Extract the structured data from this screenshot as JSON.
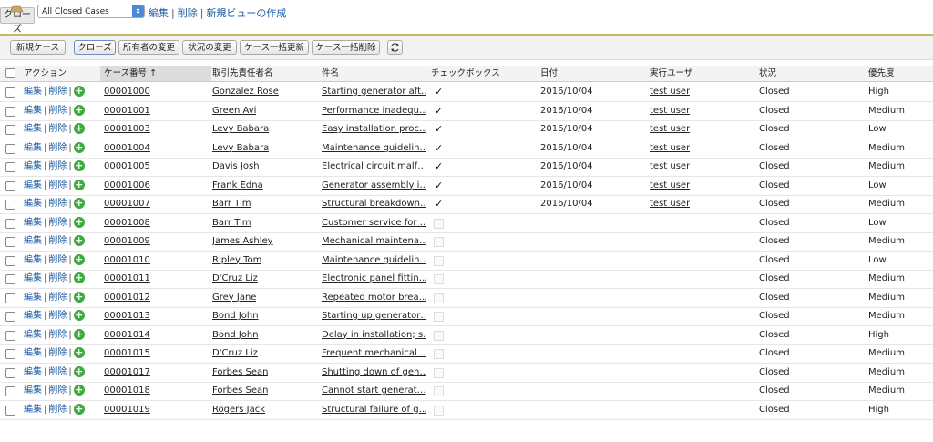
{
  "tab": {
    "label": "クローズ"
  },
  "view": {
    "selected": "All Closed Cases",
    "links": [
      "編集",
      "削除",
      "新規ビューの作成"
    ]
  },
  "toolbar": {
    "buttons": [
      "新規ケース",
      "クローズ",
      "所有者の変更",
      "状況の変更",
      "ケース一括更新",
      "ケース一括削除"
    ]
  },
  "table": {
    "headers": [
      "アクション",
      "ケース番号",
      "取引先責任者名",
      "件名",
      "チェックボックス",
      "日付",
      "実行ユーザ",
      "状況",
      "優先度"
    ],
    "sort_indicator": "↑",
    "action_edit": "編集",
    "action_delete": "削除",
    "action_plus": "+",
    "check_mark": "✓",
    "rows": [
      {
        "case": "00001000",
        "contact": "Gonzalez Rose",
        "subject": "Starting generator aft…",
        "checked": true,
        "date": "2016/10/04",
        "user": "test user",
        "status": "Closed",
        "priority": "High"
      },
      {
        "case": "00001001",
        "contact": "Green Avi",
        "subject": "Performance inadequ…",
        "checked": true,
        "date": "2016/10/04",
        "user": "test user",
        "status": "Closed",
        "priority": "Medium"
      },
      {
        "case": "00001003",
        "contact": "Levy Babara",
        "subject": "Easy installation proc…",
        "checked": true,
        "date": "2016/10/04",
        "user": "test user",
        "status": "Closed",
        "priority": "Low"
      },
      {
        "case": "00001004",
        "contact": "Levy Babara",
        "subject": "Maintenance guidelin…",
        "checked": true,
        "date": "2016/10/04",
        "user": "test user",
        "status": "Closed",
        "priority": "Medium"
      },
      {
        "case": "00001005",
        "contact": "Davis Josh",
        "subject": "Electrical circuit malf…",
        "checked": true,
        "date": "2016/10/04",
        "user": "test user",
        "status": "Closed",
        "priority": "Medium"
      },
      {
        "case": "00001006",
        "contact": "Frank Edna",
        "subject": "Generator assembly i…",
        "checked": true,
        "date": "2016/10/04",
        "user": "test user",
        "status": "Closed",
        "priority": "Low"
      },
      {
        "case": "00001007",
        "contact": "Barr Tim",
        "subject": "Structural breakdown…",
        "checked": true,
        "date": "2016/10/04",
        "user": "test user",
        "status": "Closed",
        "priority": "Medium"
      },
      {
        "case": "00001008",
        "contact": "Barr Tim",
        "subject": "Customer service for …",
        "checked": false,
        "date": "",
        "user": "",
        "status": "Closed",
        "priority": "Low"
      },
      {
        "case": "00001009",
        "contact": "James Ashley",
        "subject": "Mechanical maintena…",
        "checked": false,
        "date": "",
        "user": "",
        "status": "Closed",
        "priority": "Medium"
      },
      {
        "case": "00001010",
        "contact": "Ripley Tom",
        "subject": "Maintenance guidelin…",
        "checked": false,
        "date": "",
        "user": "",
        "status": "Closed",
        "priority": "Low"
      },
      {
        "case": "00001011",
        "contact": "D'Cruz Liz",
        "subject": "Electronic panel fittin…",
        "checked": false,
        "date": "",
        "user": "",
        "status": "Closed",
        "priority": "Medium"
      },
      {
        "case": "00001012",
        "contact": "Grey Jane",
        "subject": "Repeated motor brea…",
        "checked": false,
        "date": "",
        "user": "",
        "status": "Closed",
        "priority": "Medium"
      },
      {
        "case": "00001013",
        "contact": "Bond John",
        "subject": "Starting up generator…",
        "checked": false,
        "date": "",
        "user": "",
        "status": "Closed",
        "priority": "Medium"
      },
      {
        "case": "00001014",
        "contact": "Bond John",
        "subject": "Delay in installation; s…",
        "checked": false,
        "date": "",
        "user": "",
        "status": "Closed",
        "priority": "High"
      },
      {
        "case": "00001015",
        "contact": "D'Cruz Liz",
        "subject": "Frequent mechanical …",
        "checked": false,
        "date": "",
        "user": "",
        "status": "Closed",
        "priority": "Medium"
      },
      {
        "case": "00001017",
        "contact": "Forbes Sean",
        "subject": "Shutting down of gen…",
        "checked": false,
        "date": "",
        "user": "",
        "status": "Closed",
        "priority": "Medium"
      },
      {
        "case": "00001018",
        "contact": "Forbes Sean",
        "subject": "Cannot start generat…",
        "checked": false,
        "date": "",
        "user": "",
        "status": "Closed",
        "priority": "Medium"
      },
      {
        "case": "00001019",
        "contact": "Rogers Jack",
        "subject": "Structural failure of g…",
        "checked": false,
        "date": "",
        "user": "",
        "status": "Closed",
        "priority": "High"
      }
    ]
  }
}
